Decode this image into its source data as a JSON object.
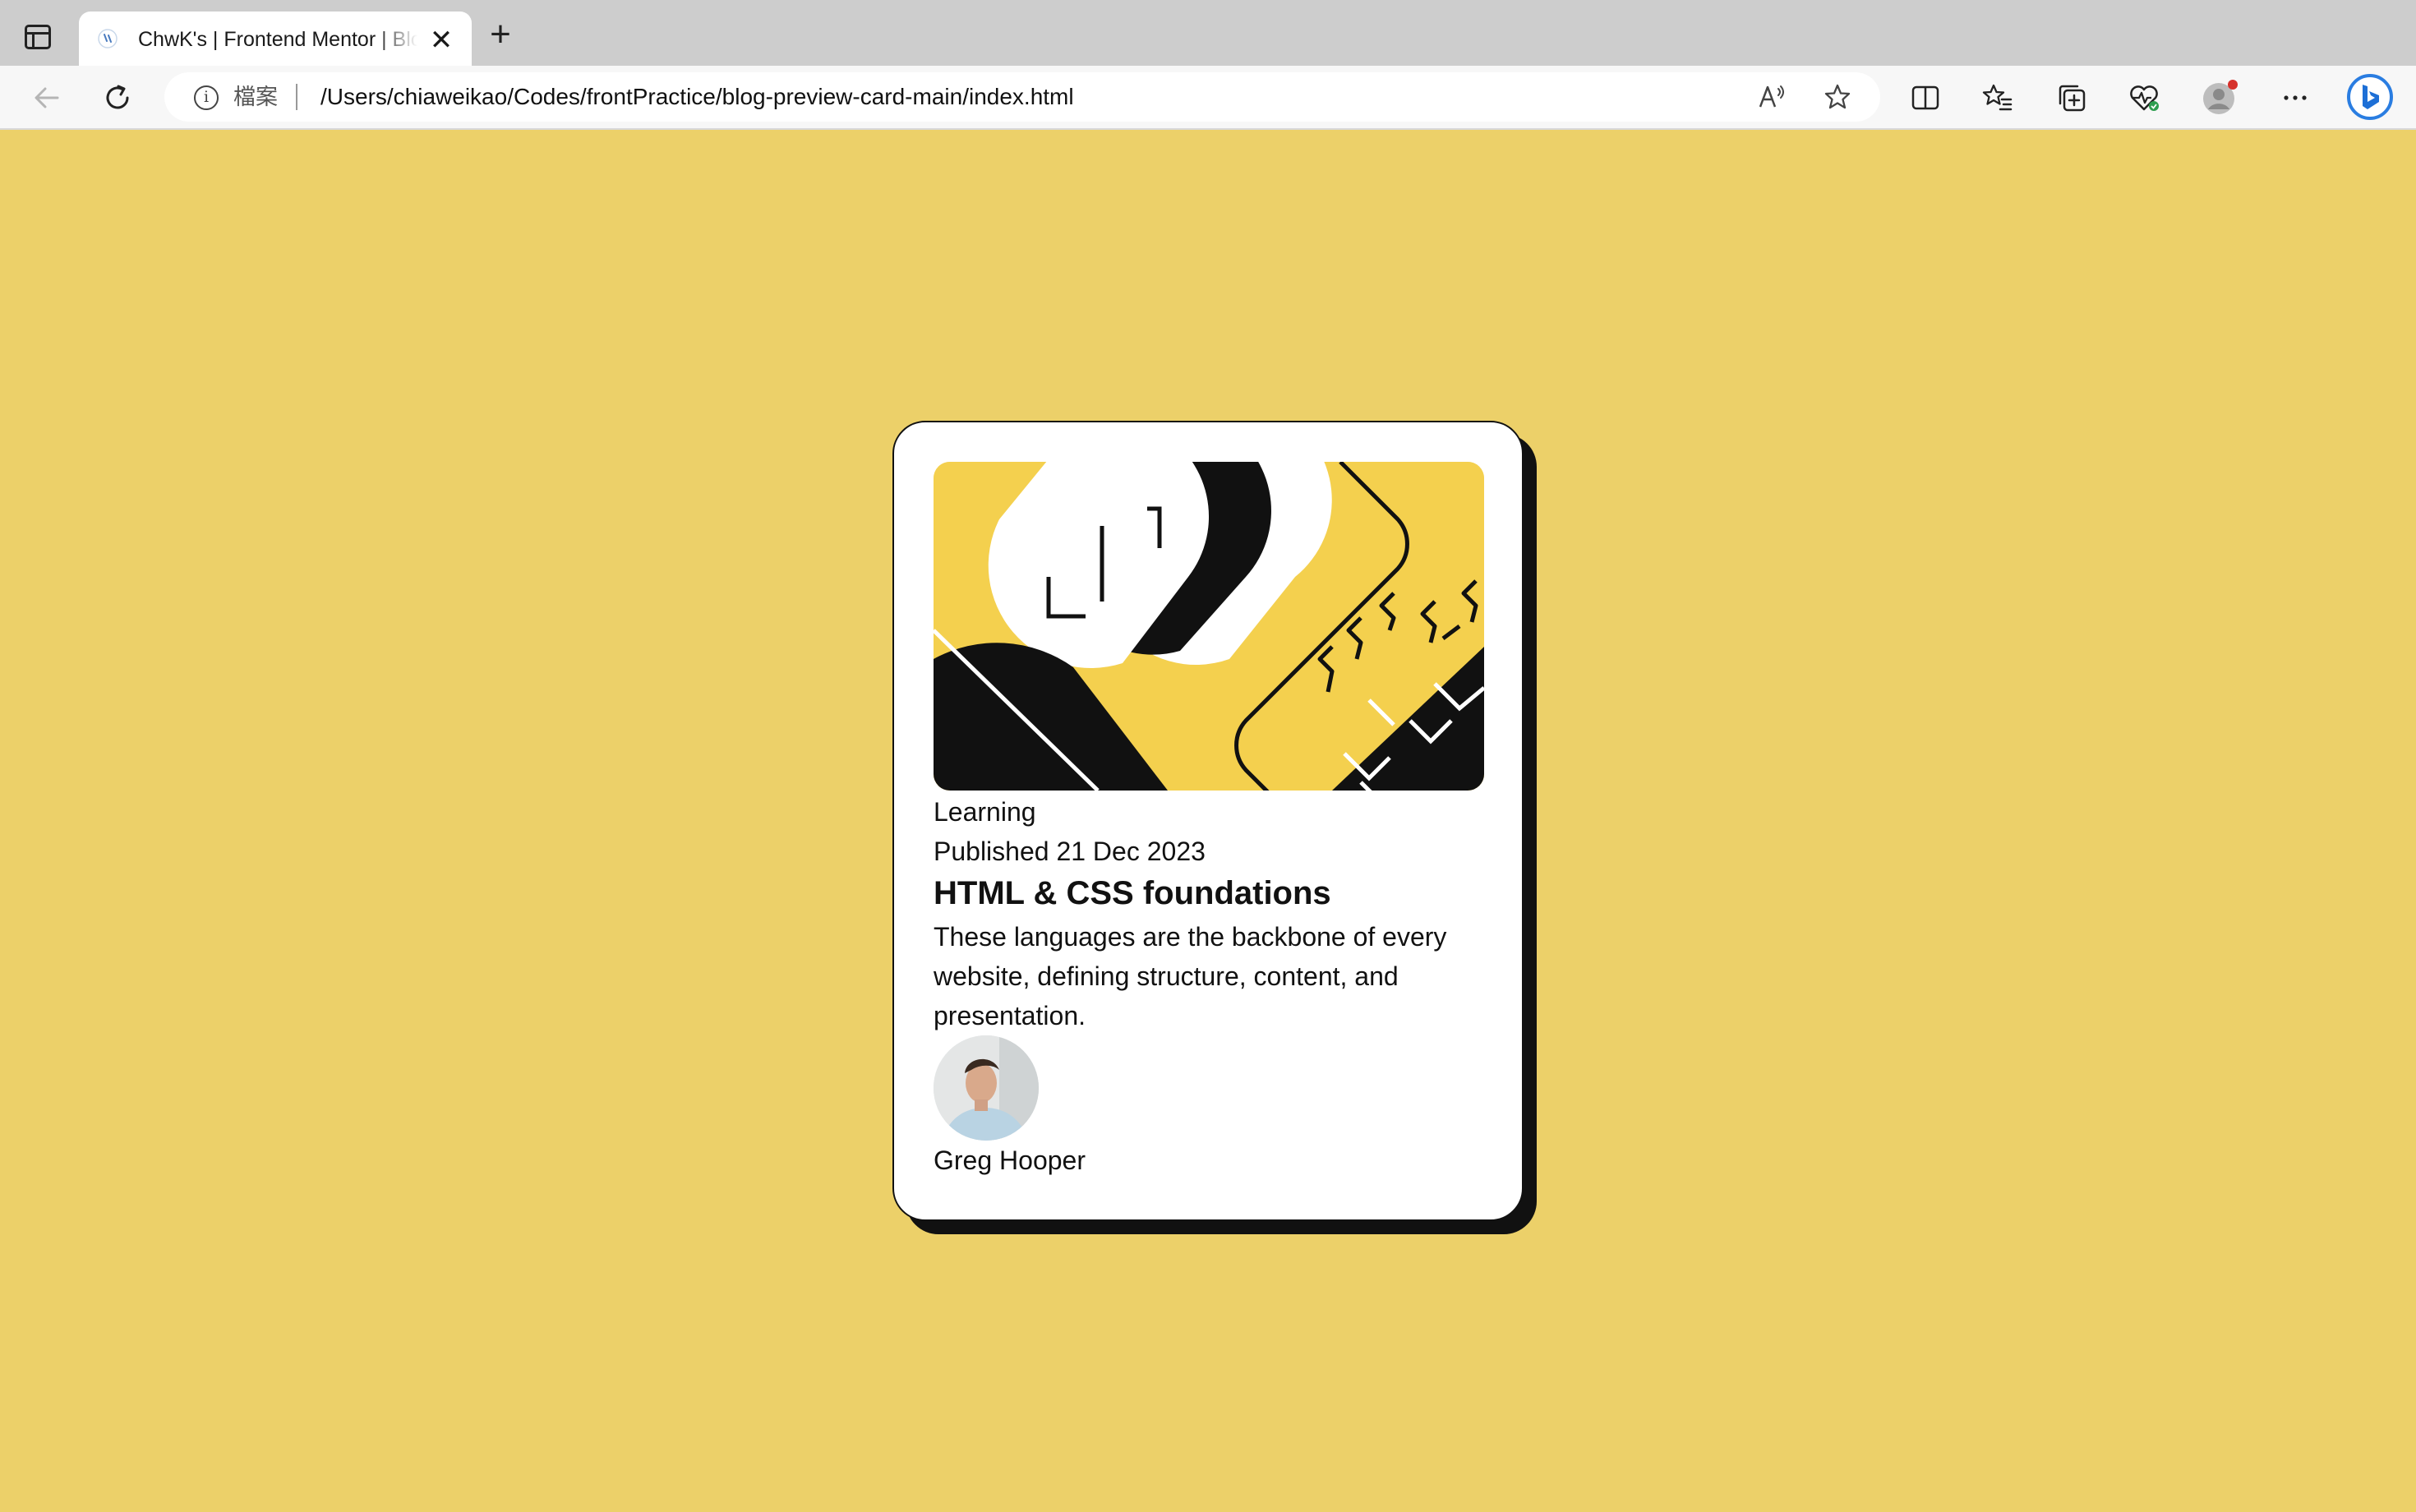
{
  "browser": {
    "tab": {
      "title": "ChwK's | Frontend Mentor | Blog preview card",
      "close_glyph": "✕"
    },
    "new_tab_glyph": "+",
    "address": {
      "scheme_label": "檔案",
      "url": "/Users/chiaweikao/Codes/frontPractice/blog-preview-card-main/index.html"
    }
  },
  "card": {
    "tag": "Learning",
    "published": "Published 21 Dec 2023",
    "title": "HTML & CSS foundations",
    "description": "These languages are the backbone of every website, defining structure, content, and presentation.",
    "author": "Greg Hooper"
  },
  "colors": {
    "page_background": "#ecd069",
    "card_background": "#ffffff",
    "card_shadow": "#111111",
    "illustration_yellow": "#f4d04e",
    "text": "#111111"
  },
  "icons": {
    "tab_panel": "tab-panel-icon",
    "back": "arrow-left-icon",
    "refresh": "refresh-icon",
    "info": "info-icon",
    "read_aloud": "read-aloud-icon",
    "favorite": "star-icon",
    "split_screen": "split-screen-icon",
    "favorites": "favorites-list-icon",
    "collections": "collections-icon",
    "browser_essentials": "heart-pulse-icon",
    "profile": "profile-avatar-icon",
    "more": "more-options-icon",
    "copilot": "bing-copilot-icon"
  }
}
